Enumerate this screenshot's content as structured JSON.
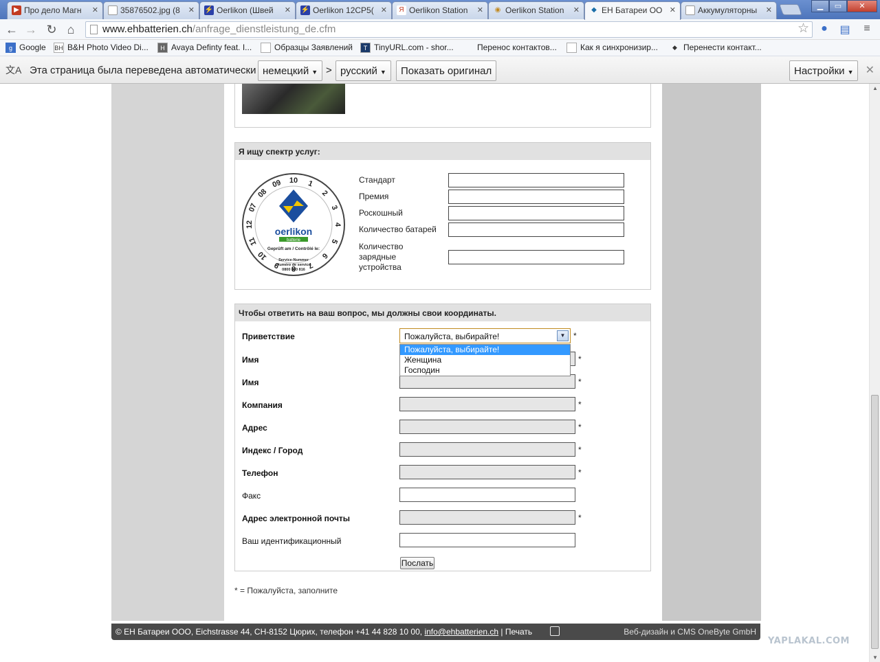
{
  "tabs": [
    {
      "title": "Про дело Магн",
      "icon": "youtube-like-icon",
      "color": "#c23b22"
    },
    {
      "title": "35876502.jpg (8",
      "icon": "page-icon",
      "color": "#888888"
    },
    {
      "title": "Oerlikon (Швей",
      "icon": "bolt-icon",
      "color": "#2a3fa8"
    },
    {
      "title": "Oerlikon 12CP5(",
      "icon": "bolt-icon",
      "color": "#2a3fa8"
    },
    {
      "title": "Oerlikon Station",
      "icon": "yandex-icon",
      "color": "#c23b22"
    },
    {
      "title": "Oerlikon Station",
      "icon": "eye-icon",
      "color": "#c28a22"
    },
    {
      "title": "ЕН Батареи ОО",
      "icon": "diamond-icon",
      "color": "#1a6ea8"
    },
    {
      "title": "Аккумуляторны",
      "icon": "page-icon",
      "color": "#888888"
    }
  ],
  "toolbar": {
    "url_host": "www.ehbatterien.ch",
    "url_path": "/anfrage_dienstleistung_de.cfm"
  },
  "bookmarks": [
    {
      "label": "Google",
      "icon": "g"
    },
    {
      "label": "B&H Photo Video Di...",
      "icon": "BH"
    },
    {
      "label": "Avaya Definty feat. I...",
      "icon": "H"
    },
    {
      "label": "Образцы Заявлений",
      "icon": ""
    },
    {
      "label": "TinyURL.com - shor...",
      "icon": "T"
    },
    {
      "label": "Перенос контактов...",
      "icon": ""
    },
    {
      "label": "Как я синхронизир...",
      "icon": ""
    },
    {
      "label": "Перенести контакт...",
      "icon": "◆"
    }
  ],
  "translate_bar": {
    "message": "Эта страница была переведена автоматически",
    "from_lang": "немецкий",
    "arrow": ">",
    "to_lang": "русский",
    "show_original": "Показать оригинал",
    "settings": "Настройки"
  },
  "services": {
    "header": "Я ищу спектр услуг:",
    "logo": {
      "brand": "oerlikon",
      "sub": "batterie",
      "check": "Geprüft am / Contrôlé le:",
      "service1": "Service-Nummer",
      "service2": "Numéro de service",
      "phone": "0800 800 816",
      "dial_numbers": [
        "10",
        "1",
        "2",
        "3",
        "4",
        "5",
        "6",
        "7",
        "8",
        "9",
        "10",
        "11",
        "12",
        "07",
        "08",
        "09"
      ]
    },
    "fields": [
      {
        "label": "Стандарт"
      },
      {
        "label": "Премия"
      },
      {
        "label": "Роскошный"
      },
      {
        "label": "Количество батарей"
      },
      {
        "label": "Количество зарядные устройства"
      }
    ]
  },
  "contact": {
    "header": "Чтобы ответить на ваш вопрос, мы должны свои координаты.",
    "salutation_label": "Приветствие",
    "salutation_value": "Пожалуйста, выбирайте!",
    "salutation_options": [
      "Пожалуйста, выбирайте!",
      "Женщина",
      "Господин"
    ],
    "fields": [
      {
        "label": "Имя",
        "required": true
      },
      {
        "label": "Имя",
        "required": true
      },
      {
        "label": "Компания",
        "required": true
      },
      {
        "label": "Адрес",
        "required": true
      },
      {
        "label": "Индекс / Город",
        "required": true
      },
      {
        "label": "Телефон",
        "required": true
      },
      {
        "label": "Факс",
        "required": false
      },
      {
        "label": "Адрес электронной почты",
        "required": true
      },
      {
        "label": "Ваш идентификационный",
        "required": false
      }
    ],
    "required_mark": "*",
    "submit": "Послать"
  },
  "footnote": "* = Пожалуйста, заполните",
  "footer": {
    "company": "© ЕН Батареи ООО, Eichstrasse 44, CH-8152 Цюрих, телефон +41 44 828 10 00,",
    "email": "info@ehbatterien.ch",
    "print": "| Печать",
    "credit": "Веб-дизайн и CMS OneByte GmbH"
  },
  "watermark": "YAPLAKAL.COM"
}
